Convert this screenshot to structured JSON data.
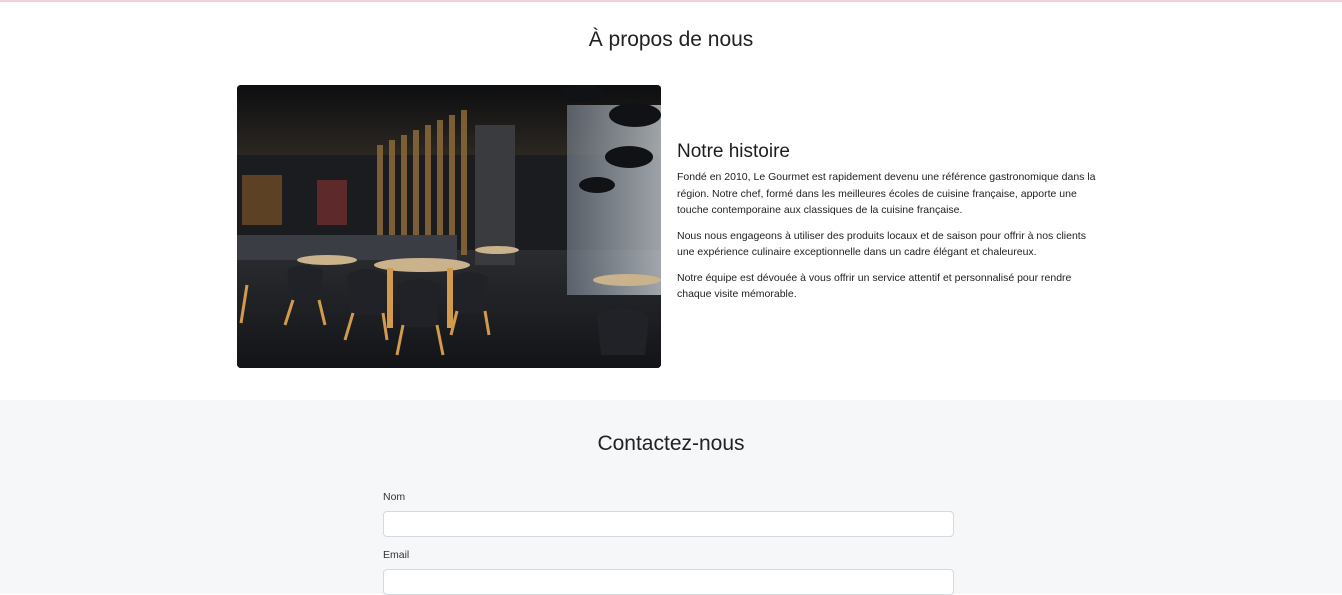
{
  "about": {
    "title": "À propos de nous",
    "image_alt": "restaurant-interior-photo",
    "story": {
      "title": "Notre histoire",
      "paragraphs": [
        "Fondé en 2010, Le Gourmet est rapidement devenu une référence gastronomique dans la région. Notre chef, formé dans les meilleures écoles de cuisine française, apporte une touche contemporaine aux classiques de la cuisine française.",
        "Nous nous engageons à utiliser des produits locaux et de saison pour offrir à nos clients une expérience culinaire exceptionnelle dans un cadre élégant et chaleureux.",
        "Notre équipe est dévouée à vous offrir un service attentif et personnalisé pour rendre chaque visite mémorable."
      ]
    }
  },
  "contact": {
    "title": "Contactez-nous",
    "name_label": "Nom",
    "name_value": "",
    "email_label": "Email",
    "email_value": ""
  },
  "colors": {
    "accent_line": "#f3d3d8",
    "contact_background": "#f6f7f9"
  }
}
